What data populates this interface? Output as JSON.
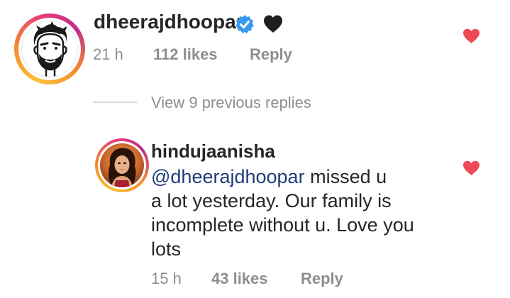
{
  "parent_comment": {
    "username": "dheerajdhoopar",
    "verified_icon": "verified-badge-icon",
    "emoji_icon": "black-heart-icon",
    "time": "21 h",
    "likes": "112 likes",
    "reply_label": "Reply",
    "like_icon": "heart-icon",
    "like_color": "#ed4956"
  },
  "replies_toggle": {
    "label": "View 9 previous replies"
  },
  "reply_comment": {
    "username": "hindujaanisha",
    "mention": "@dheerajdhoopar",
    "text_lines": [
      " missed u",
      "a lot yesterday. Our family is",
      "incomplete without u. Love you",
      "lots"
    ],
    "time": "15 h",
    "likes": "43 likes",
    "reply_label": "Reply",
    "like_icon": "heart-icon",
    "like_color": "#ed4956"
  },
  "colors": {
    "verified": "#3897f0",
    "mention": "#1f3d7a",
    "muted": "#8e8e8e",
    "story_ring": "#e9407a"
  }
}
